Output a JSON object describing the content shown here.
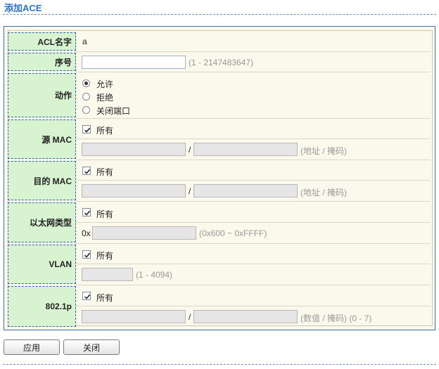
{
  "page": {
    "title": "添加ACE"
  },
  "form": {
    "acl_name": {
      "label": "ACL名字",
      "value": "a"
    },
    "sequence": {
      "label": "序号",
      "value": "",
      "hint": "(1 - 2147483647)"
    },
    "action": {
      "label": "动作",
      "options": [
        "允许",
        "拒绝",
        "关闭端口"
      ],
      "selected": "允许"
    },
    "src_mac": {
      "label": "源 MAC",
      "all_label": "所有",
      "all_checked": true,
      "separator": "/",
      "hint": "(地址 / 掩码)"
    },
    "dst_mac": {
      "label": "目的 MAC",
      "all_label": "所有",
      "all_checked": true,
      "separator": "/",
      "hint": "(地址 / 掩码)"
    },
    "ethertype": {
      "label": "以太网类型",
      "all_label": "所有",
      "all_checked": true,
      "prefix": "0x",
      "hint": "(0x600 ~ 0xFFFF)"
    },
    "vlan": {
      "label": "VLAN",
      "all_label": "所有",
      "all_checked": true,
      "hint": "(1 - 4094)"
    },
    "dot1p": {
      "label": "802.1p",
      "all_label": "所有",
      "all_checked": true,
      "separator": "/",
      "hint": "(数值 / 掩码) (0 - 7)"
    }
  },
  "buttons": {
    "apply": "应用",
    "close": "关闭"
  }
}
